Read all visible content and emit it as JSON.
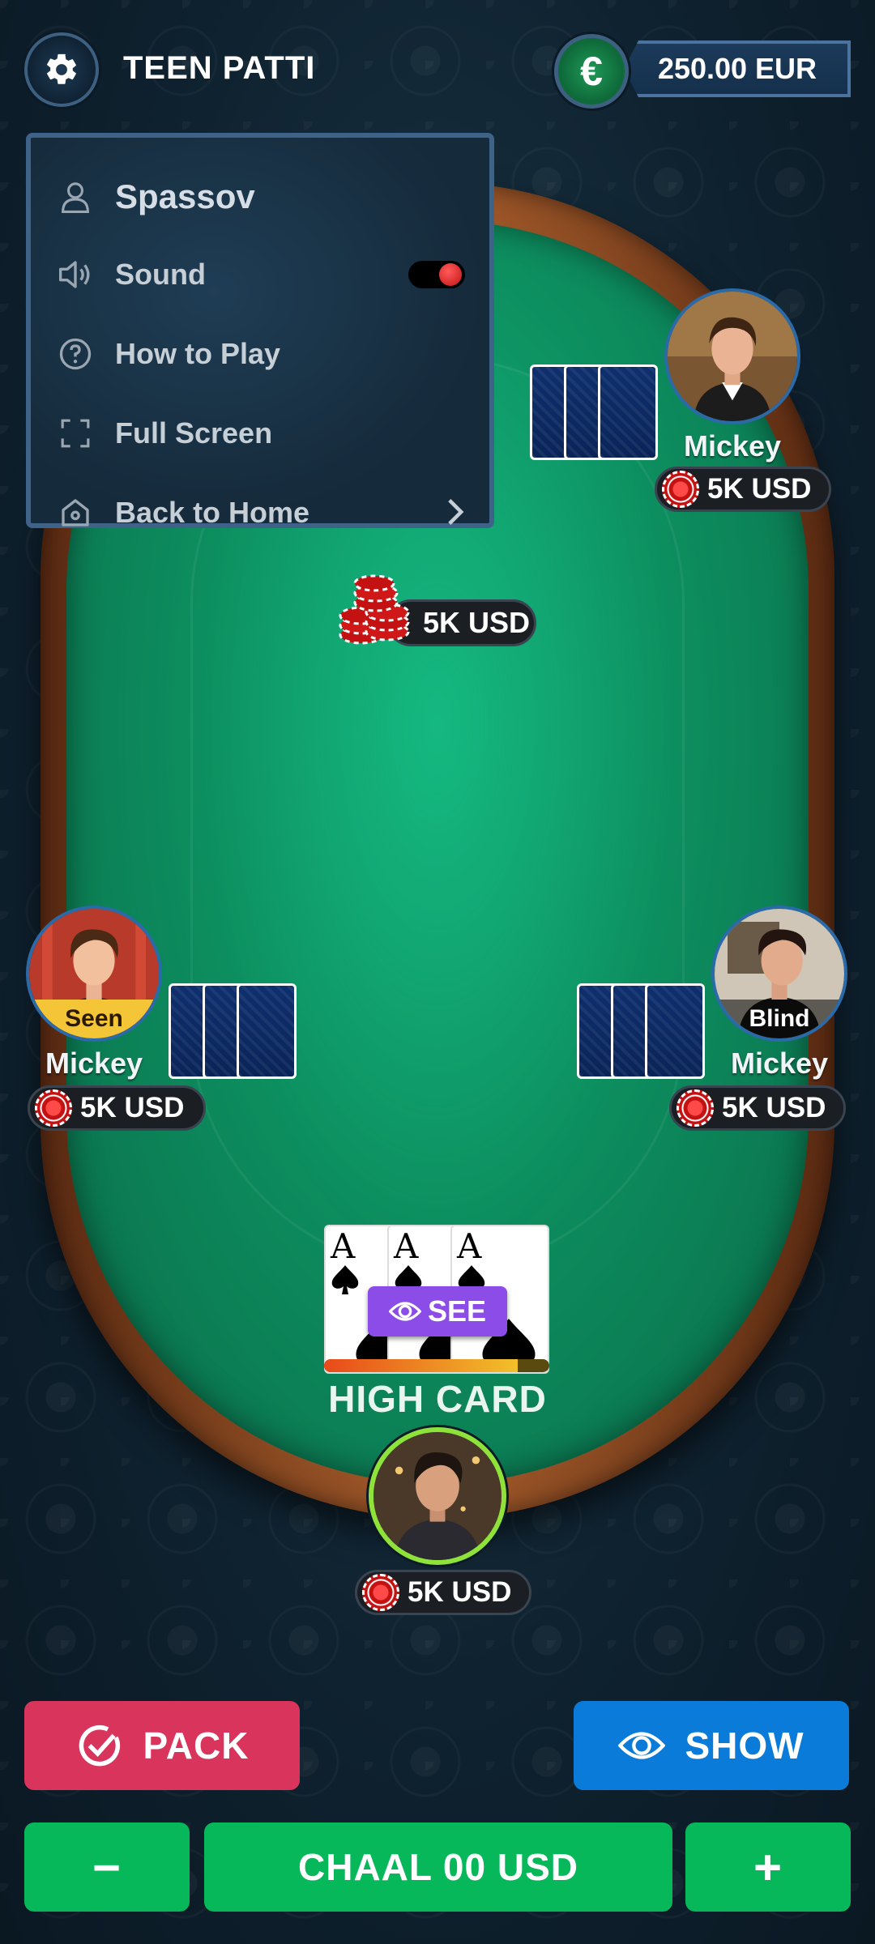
{
  "header": {
    "title": "TEEN PATTI",
    "currency_symbol": "€",
    "balance": "250.00 EUR"
  },
  "menu": {
    "username": "Spassov",
    "sound_label": "Sound",
    "sound_on": true,
    "how_to_play_label": "How to Play",
    "full_screen_label": "Full Screen",
    "back_home_label": "Back to Home"
  },
  "pot": {
    "amount": "5K USD"
  },
  "players": [
    {
      "name": "Mickey",
      "amount": "5K USD",
      "status": ""
    },
    {
      "name": "Mickey",
      "amount": "5K USD",
      "status": "Seen"
    },
    {
      "name": "Mickey",
      "amount": "5K USD",
      "status": "Blind"
    }
  ],
  "me": {
    "cards": [
      "A",
      "A",
      "A"
    ],
    "suit": "spades",
    "see_label": "SEE",
    "hand_label": "HIGH CARD",
    "amount": "5K USD",
    "timer_fraction": 0.86
  },
  "actions": {
    "pack_label": "PACK",
    "show_label": "SHOW",
    "minus_label": "−",
    "chaal_label": "CHAAL 00 USD",
    "plus_label": "+"
  },
  "colors": {
    "pack": "#d9345c",
    "show": "#0a7bd8",
    "chaal": "#07b85a",
    "felt": "#0d8f60",
    "see": "#8b4ce8"
  }
}
